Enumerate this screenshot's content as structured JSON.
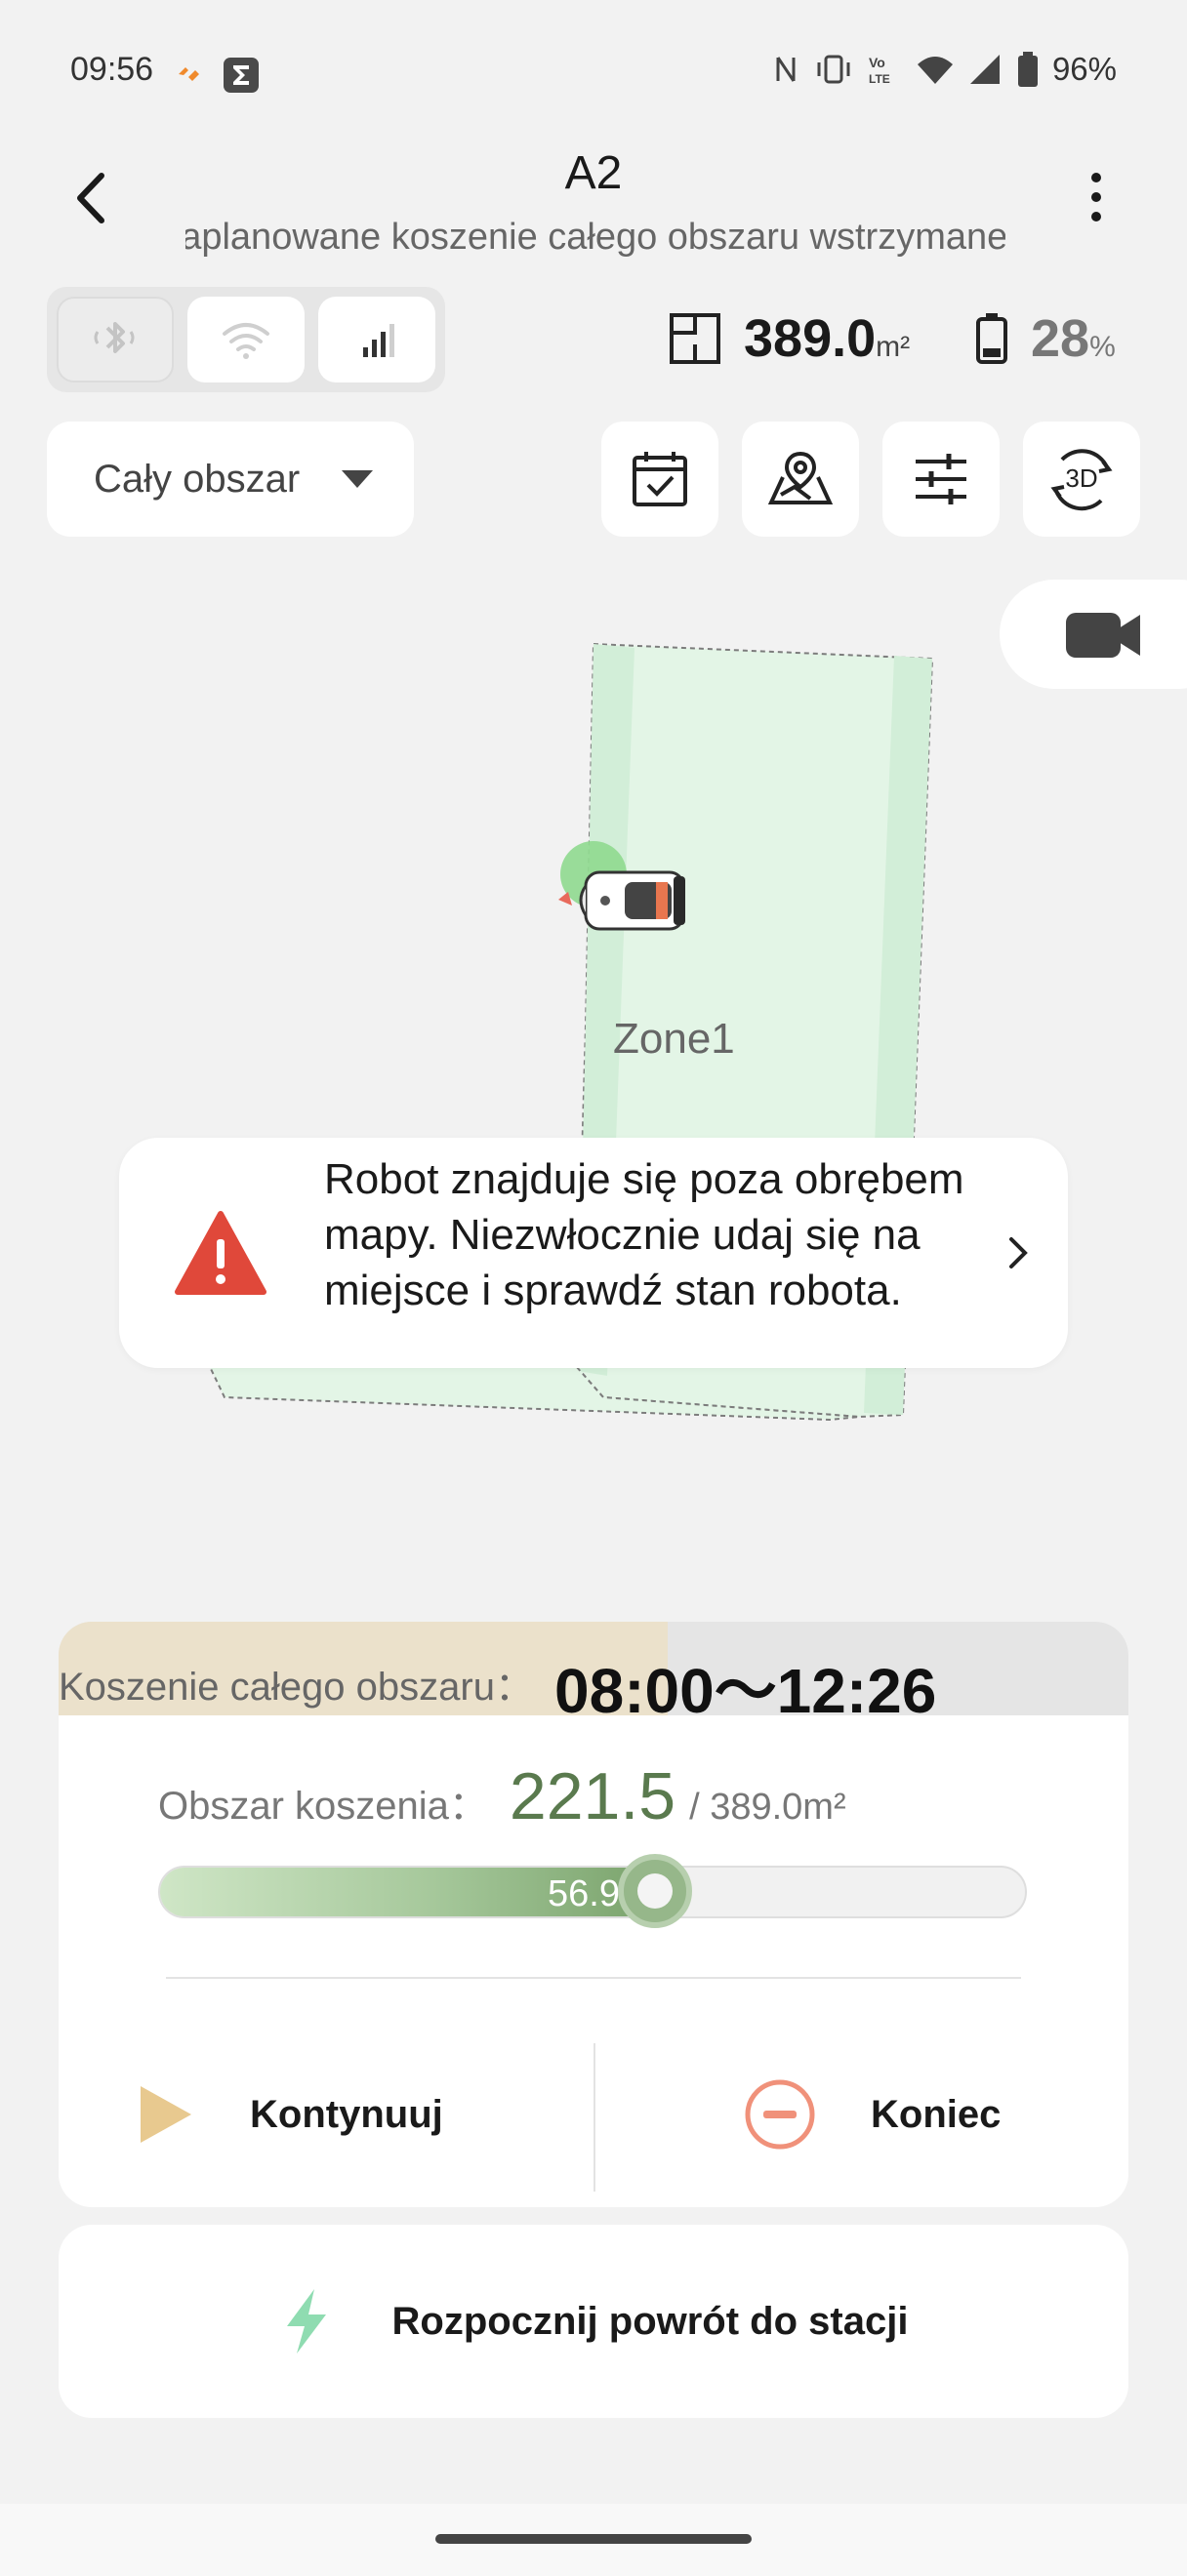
{
  "status_bar": {
    "time": "09:56",
    "battery": "96%",
    "icons": [
      "orange-app-icon",
      "sigma-app-icon",
      "nfc-icon",
      "vibrate-icon",
      "volte-icon",
      "wifi-icon",
      "signal-icon",
      "battery-icon"
    ]
  },
  "header": {
    "title": "A2",
    "subtitle": "Zaplanowane koszenie całego obszaru wstrzymane"
  },
  "connectivity": {
    "items": [
      "bluetooth-icon",
      "wifi-icon",
      "cellular-signal-icon"
    ]
  },
  "stats": {
    "area_value": "389.0",
    "area_unit": "m²",
    "battery_value": "28",
    "battery_unit": "%"
  },
  "toolbar": {
    "zone_select": "Cały obszar",
    "buttons": [
      "calendar-icon",
      "map-pin-icon",
      "sliders-icon",
      "view-3d-icon"
    ],
    "view_3d_label": "3D"
  },
  "map": {
    "zone_label": "Zone1"
  },
  "alert": {
    "message": "Robot znajduje się poza obrębem mapy. Niezwłocznie udaj się na miejsce i sprawdź stan robota."
  },
  "progress_card": {
    "task_label": "Koszenie całego obszaru：",
    "time_range": "08:00〜12:26",
    "mow_label": "Obszar koszenia：",
    "mowed_value": "221.5",
    "total_value": "/ 389.0m²",
    "percent_text": "56.95%",
    "progress_fraction": 0.5695,
    "continue_label": "Kontynuuj",
    "end_label": "Koniec"
  },
  "return": {
    "label": "Rozpocznij powrót do stacji"
  },
  "colors": {
    "accent_green": "#5a7a4e",
    "zone_fill": "#e3f5e6",
    "alert_red": "#e0483a",
    "continue_gold": "#e8c98f",
    "end_coral": "#f0917a",
    "return_green": "#8fdcb1"
  }
}
